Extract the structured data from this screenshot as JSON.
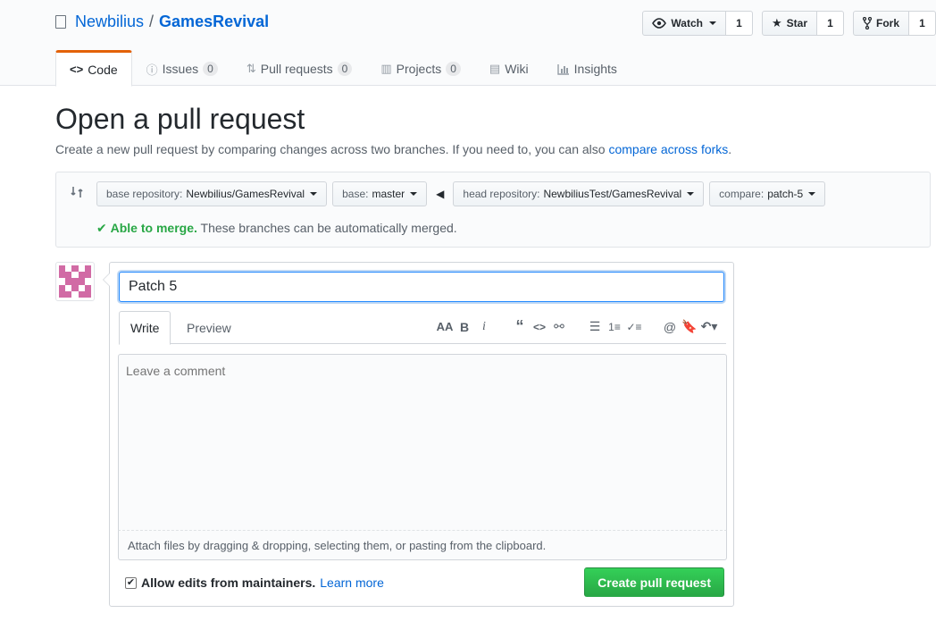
{
  "repo": {
    "owner": "Newbilius",
    "separator": "/",
    "name": "GamesRevival"
  },
  "actions": {
    "watch": {
      "label": "Watch",
      "count": "1"
    },
    "star": {
      "label": "Star",
      "count": "1"
    },
    "fork": {
      "label": "Fork",
      "count": "1"
    }
  },
  "nav": {
    "code": {
      "label": "Code"
    },
    "issues": {
      "label": "Issues",
      "count": "0"
    },
    "pulls": {
      "label": "Pull requests",
      "count": "0"
    },
    "projects": {
      "label": "Projects",
      "count": "0"
    },
    "wiki": {
      "label": "Wiki"
    },
    "insights": {
      "label": "Insights"
    }
  },
  "page": {
    "title": "Open a pull request",
    "lead": "Create a new pull request by comparing changes across two branches. If you need to, you can also ",
    "lead_link": "compare across forks",
    "lead_end": "."
  },
  "range": {
    "base_repo_label": "base repository: ",
    "base_repo_value": "Newbilius/GamesRevival",
    "base_label": "base: ",
    "base_value": "master",
    "head_repo_label": "head repository: ",
    "head_repo_value": "NewbiliusTest/GamesRevival",
    "compare_label": "compare: ",
    "compare_value": "patch-5",
    "merge_ok": "Able to merge.",
    "merge_text": " These branches can be automatically merged."
  },
  "form": {
    "title_value": "Patch 5",
    "tab_write": "Write",
    "tab_preview": "Preview",
    "comment_placeholder": "Leave a comment",
    "attach_text": "Attach files by dragging & dropping, selecting them, or pasting from the clipboard.",
    "allow_label": "Allow edits from maintainers.",
    "learn_more": "Learn more",
    "create_button": "Create pull request"
  },
  "colors": {
    "accent": "#0366d6",
    "success": "#28a745",
    "nav_active": "#e36209"
  }
}
